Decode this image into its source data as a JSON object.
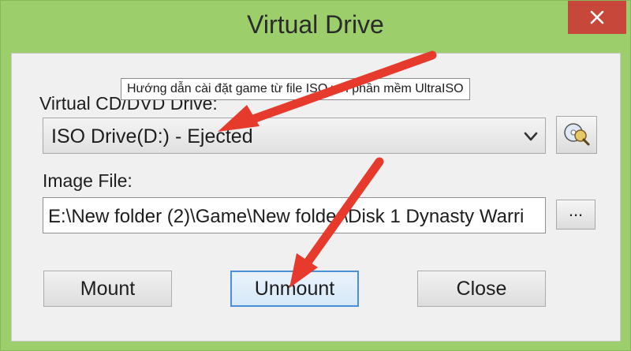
{
  "window": {
    "title": "Virtual Drive",
    "close_icon": "close-icon",
    "frame_color": "#9ccf6b",
    "close_color": "#c7473a"
  },
  "tooltip": {
    "text": "Hướng dẫn cài đặt game từ file ISO với phần mềm UltraISO"
  },
  "drive": {
    "label": "Virtual CD/DVD Drive:",
    "selected": "ISO Drive(D:) - Ejected",
    "dropdown_icon": "chevron-down-icon",
    "browse_icon": "disc-search-icon"
  },
  "image": {
    "label": "Image File:",
    "value": "E:\\New folder (2)\\Game\\New folder\\Disk 1 Dynasty Warri",
    "browse_label": "..."
  },
  "buttons": {
    "mount": "Mount",
    "unmount": "Unmount",
    "close": "Close"
  },
  "annotation": {
    "arrow_color": "#e63a2c"
  }
}
